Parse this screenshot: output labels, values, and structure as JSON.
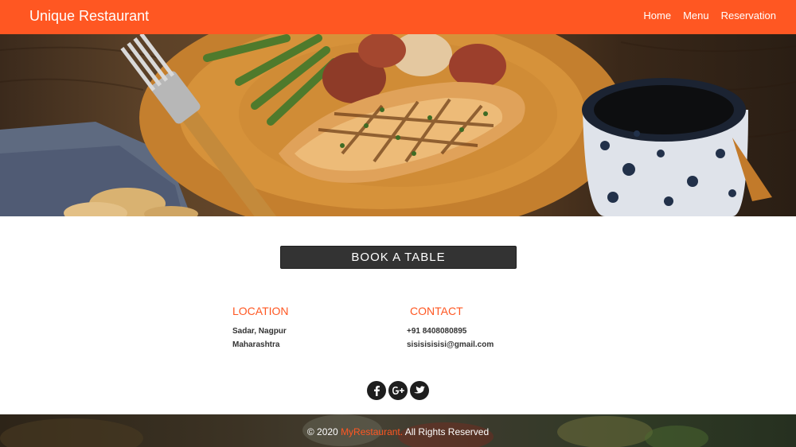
{
  "header": {
    "brand": "Unique Restaurant",
    "nav": [
      {
        "label": "Home"
      },
      {
        "label": "Menu"
      },
      {
        "label": "Reservation"
      }
    ]
  },
  "hero": {
    "image": "grilled-fish-plate-photo"
  },
  "booking": {
    "button_label": "BOOK A TABLE"
  },
  "location": {
    "heading": "LOCATION",
    "line1": "Sadar, Nagpur",
    "line2": "Maharashtra"
  },
  "contact": {
    "heading": "CONTACT",
    "phone": "+91 8408080895",
    "email": "sisisisisisi@gmail.com"
  },
  "social": [
    {
      "icon": "facebook-icon"
    },
    {
      "icon": "google-plus-icon"
    },
    {
      "icon": "twitter-icon"
    }
  ],
  "footer": {
    "copyright_prefix": "© 2020 ",
    "brand_link": "MyRestaurant.",
    "copyright_suffix": " All Rights Reserved"
  },
  "colors": {
    "accent": "#ff5722",
    "dark": "#333333"
  }
}
